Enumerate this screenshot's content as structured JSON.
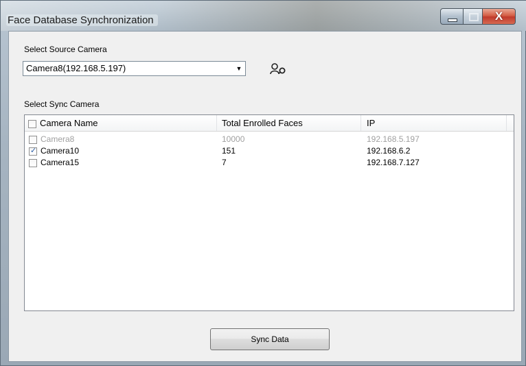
{
  "window": {
    "title": "Face Database Synchronization",
    "close_glyph": "X"
  },
  "source": {
    "label": "Select Source Camera",
    "selected": "Camera8(192.168.5.197)",
    "dropdown_icon": "triangle-down",
    "face_icon": "face-search-icon"
  },
  "sync": {
    "label": "Select Sync Camera",
    "columns": [
      "Camera Name",
      "Total Enrolled Faces",
      "IP"
    ],
    "rows": [
      {
        "name": "Camera8",
        "total": "10000",
        "ip": "192.168.5.197",
        "checked": false,
        "disabled": true
      },
      {
        "name": "Camera10",
        "total": "151",
        "ip": "192.168.6.2",
        "checked": true,
        "disabled": false
      },
      {
        "name": "Camera15",
        "total": "7",
        "ip": "192.168.7.127",
        "checked": false,
        "disabled": false
      }
    ]
  },
  "actions": {
    "sync_label": "Sync Data"
  }
}
